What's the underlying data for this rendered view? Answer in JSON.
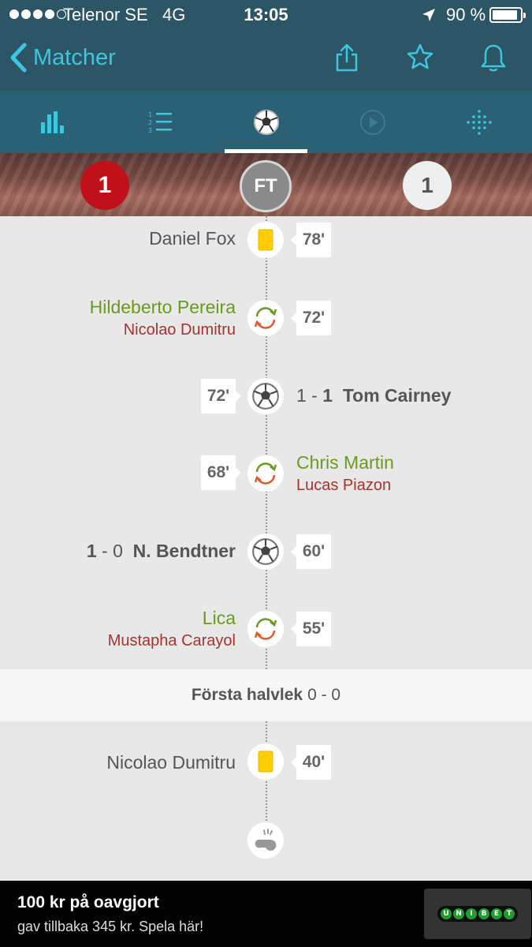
{
  "status_bar": {
    "carrier": "Telenor SE",
    "network": "4G",
    "time": "13:05",
    "battery": "90 %"
  },
  "nav": {
    "back_label": "Matcher",
    "icons": [
      "share-icon",
      "star-icon",
      "bell-icon"
    ]
  },
  "tabs": [
    {
      "icon": "stats-icon",
      "active": false
    },
    {
      "icon": "lineup-list-icon",
      "active": false
    },
    {
      "icon": "football-icon",
      "active": true
    },
    {
      "icon": "play-icon",
      "active": false
    },
    {
      "icon": "dots-grid-icon",
      "active": false
    }
  ],
  "score": {
    "home": "1",
    "status": "FT",
    "away": "1",
    "home_color": "#c0101a"
  },
  "events": [
    {
      "type": "yellow-card",
      "side": "home",
      "minute": "78'",
      "player": "Daniel Fox"
    },
    {
      "type": "substitution",
      "side": "home",
      "minute": "72'",
      "player_in": "Hildeberto Pereira",
      "player_out": "Nicolao Dumitru"
    },
    {
      "type": "goal",
      "side": "away",
      "minute": "72'",
      "score_a": "1",
      "score_sep": " - ",
      "score_b": "1",
      "player": "Tom Cairney"
    },
    {
      "type": "substitution",
      "side": "away",
      "minute": "68'",
      "player_in": "Chris Martin",
      "player_out": "Lucas Piazon"
    },
    {
      "type": "goal",
      "side": "home",
      "minute": "60'",
      "score_a": "1",
      "score_sep": " - ",
      "score_b": "0",
      "player": "N. Bendtner"
    },
    {
      "type": "substitution",
      "side": "home",
      "minute": "55'",
      "player_in": "Lica",
      "player_out": "Mustapha Carayol"
    }
  ],
  "half": {
    "label": "Första halvlek",
    "score": "0 - 0"
  },
  "events_first_half": [
    {
      "type": "yellow-card",
      "side": "home",
      "minute": "40'",
      "player": "Nicolao Dumitru"
    }
  ],
  "kickoff_icon": "whistle-icon",
  "ad": {
    "title": "100 kr på oavgjort",
    "subtitle": "gav tillbaka 345 kr. Spela här!",
    "logo_text": "UNIBET"
  },
  "colors": {
    "accent": "#3cc7e0",
    "header": "#2c5566",
    "tabbar": "#2a6174",
    "sub_in": "#6a9a1e",
    "sub_out": "#a8322c",
    "yellow_card": "#ffcc00"
  }
}
